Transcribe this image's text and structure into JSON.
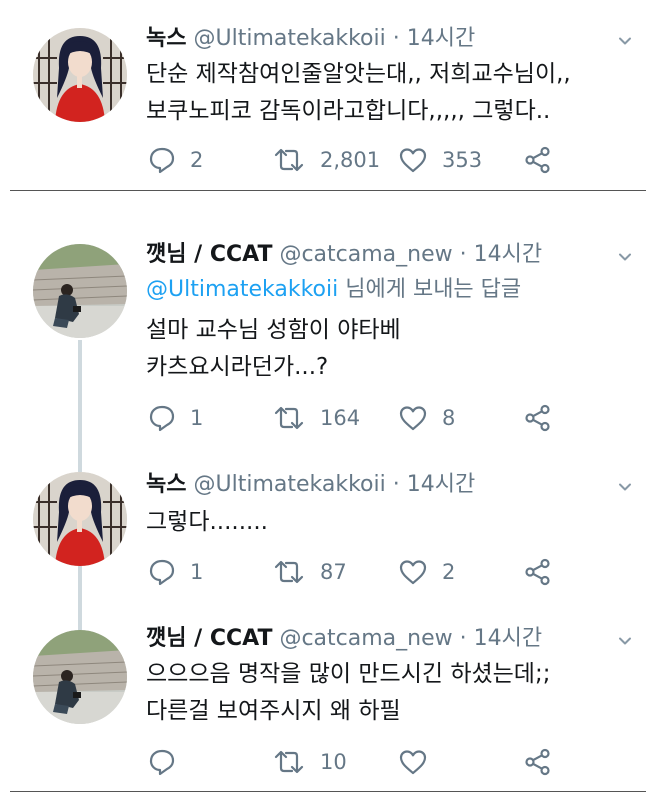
{
  "tweets": [
    {
      "avatar": "avatar-red-jacket",
      "name": "녹스",
      "meta": "@Ultimatekakkoii · 14시간",
      "reply_prefix": "",
      "reply_mention": "",
      "reply_suffix": "",
      "lines": [
        "단순 제작참여인줄알앗는대,, 저희교수님이,,",
        "보쿠노피코 감독이라고합니다,,,,, 그렇다.."
      ],
      "replies": "2",
      "retweets": "2,801",
      "likes": "353"
    },
    {
      "avatar": "avatar-photographer",
      "name": "꺳님 / CCAT",
      "meta": "@catcama_new · 14시간",
      "reply_prefix": "",
      "reply_mention": "@Ultimatekakkoii",
      "reply_suffix": " 님에게 보내는 답글",
      "lines": [
        "설마 교수님 성함이 야타베",
        "카츠요시라던가...?"
      ],
      "replies": "1",
      "retweets": "164",
      "likes": "8"
    },
    {
      "avatar": "avatar-red-jacket",
      "name": "녹스",
      "meta": "@Ultimatekakkoii · 14시간",
      "lines": [
        "그렇다........"
      ],
      "replies": "1",
      "retweets": "87",
      "likes": "2"
    },
    {
      "avatar": "avatar-photographer",
      "name": "꺳님 / CCAT",
      "meta": "@catcama_new · 14시간",
      "lines": [
        "으으으음 명작을 많이 만드시긴 하셨는데;;",
        "다른걸 보여주시지 왜 하필"
      ],
      "replies": "",
      "retweets": "10",
      "likes": ""
    }
  ],
  "colors": {
    "text": "#14171a",
    "meta": "#657786",
    "mention": "#1da1f2",
    "line": "#cfd9de"
  },
  "icons": [
    "reply-icon",
    "retweet-icon",
    "like-icon",
    "share-icon",
    "caret-down-icon"
  ]
}
